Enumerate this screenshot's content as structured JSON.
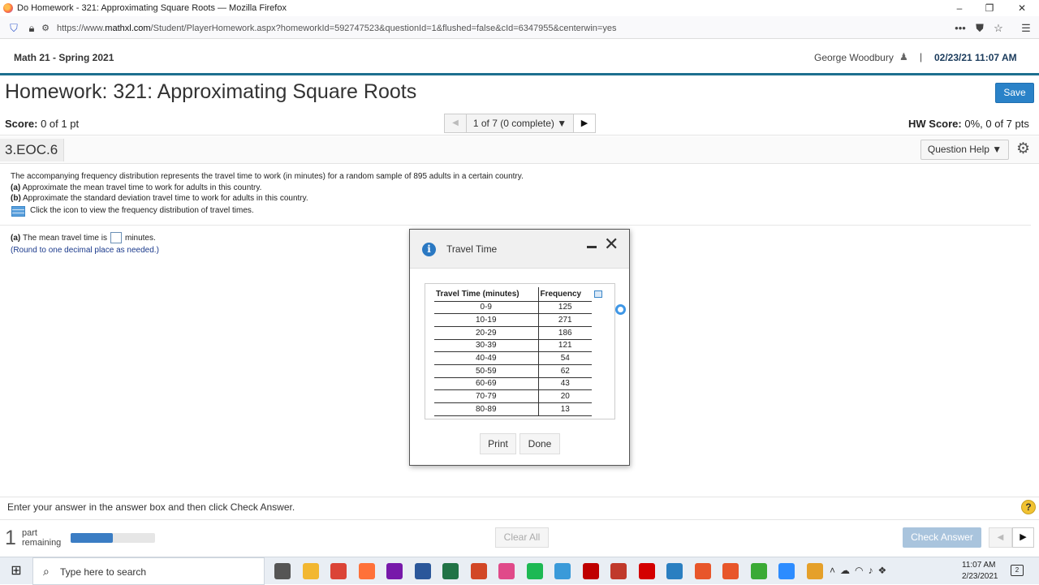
{
  "window": {
    "title": "Do Homework - 321: Approximating Square Roots — Mozilla Firefox"
  },
  "browser": {
    "url_prefix": "https://www.",
    "url_domain": "mathxl.com",
    "url_rest": "/Student/PlayerHomework.aspx?homeworkId=592747523&questionId=1&flushed=false&cId=6347955&centerwin=yes"
  },
  "header": {
    "course": "Math 21 - Spring 2021",
    "user": "George Woodbury",
    "separator": "|",
    "datetime": "02/23/21 11:07 AM"
  },
  "homework": {
    "title": "Homework: 321: Approximating Square Roots",
    "save_label": "Save",
    "score_label": "Score:",
    "score_value": "0 of 1 pt",
    "pager_text": "1 of 7 (0 complete)",
    "hw_score_label": "HW Score:",
    "hw_score_value": "0%, 0 of 7 pts"
  },
  "question": {
    "id": "3.EOC.6",
    "help_label": "Question Help",
    "intro": "The accompanying frequency distribution represents the travel time to work (in minutes) for a random sample of 895 adults in a certain country.",
    "part_a_tag": "(a)",
    "part_a_text": " Approximate the mean travel time to work for adults in this country.",
    "part_b_tag": "(b)",
    "part_b_text": " Approximate the standard deviation travel time to work for adults in this country.",
    "icon_text": "Click the icon to view the frequency distribution of travel times.",
    "answer_tag": "(a)",
    "answer_prefix": "The mean travel time is",
    "answer_suffix": "minutes.",
    "round_note": "(Round to one decimal place as needed.)"
  },
  "footer": {
    "instruction": "Enter your answer in the answer box and then click Check Answer.",
    "parts_number": "1",
    "parts_label_1": "part",
    "parts_label_2": "remaining",
    "progress_fraction": 0.5,
    "clear_label": "Clear All",
    "check_label": "Check Answer",
    "help_symbol": "?"
  },
  "modal": {
    "title": "Travel Time",
    "col1": "Travel Time (minutes)",
    "col2": "Frequency",
    "rows": [
      {
        "range": "0-9",
        "freq": "125"
      },
      {
        "range": "10-19",
        "freq": "271"
      },
      {
        "range": "20-29",
        "freq": "186"
      },
      {
        "range": "30-39",
        "freq": "121"
      },
      {
        "range": "40-49",
        "freq": "54"
      },
      {
        "range": "50-59",
        "freq": "62"
      },
      {
        "range": "60-69",
        "freq": "43"
      },
      {
        "range": "70-79",
        "freq": "20"
      },
      {
        "range": "80-89",
        "freq": "13"
      }
    ],
    "print_label": "Print",
    "done_label": "Done"
  },
  "taskbar": {
    "search_placeholder": "Type here to search",
    "time": "11:07 AM",
    "date": "2/23/2021",
    "notifications": "2",
    "apps": [
      {
        "icon": "task-view-icon",
        "color": "#555555"
      },
      {
        "icon": "file-explorer-icon",
        "color": "#f2b731"
      },
      {
        "icon": "chrome-icon",
        "color": "#db4437"
      },
      {
        "icon": "firefox-icon",
        "color": "#ff7139"
      },
      {
        "icon": "onenote-icon",
        "color": "#7719aa"
      },
      {
        "icon": "word-icon",
        "color": "#2b579a"
      },
      {
        "icon": "excel-icon",
        "color": "#217346"
      },
      {
        "icon": "powerpoint-icon",
        "color": "#d24726"
      },
      {
        "icon": "app-icon",
        "color": "#e04a8a"
      },
      {
        "icon": "spotify-icon",
        "color": "#1db954"
      },
      {
        "icon": "app-icon",
        "color": "#3a9ad9"
      },
      {
        "icon": "filezilla-icon",
        "color": "#bf0000"
      },
      {
        "icon": "app-icon",
        "color": "#c0392b"
      },
      {
        "icon": "acrobat-icon",
        "color": "#d40000"
      },
      {
        "icon": "app-icon",
        "color": "#2a7fc1"
      },
      {
        "icon": "app-icon",
        "color": "#e8562a"
      },
      {
        "icon": "app-icon",
        "color": "#e8562a"
      },
      {
        "icon": "app-icon",
        "color": "#3aaa35"
      },
      {
        "icon": "zoom-icon",
        "color": "#2d8cff"
      },
      {
        "icon": "app-icon",
        "color": "#e5a02a"
      }
    ]
  }
}
